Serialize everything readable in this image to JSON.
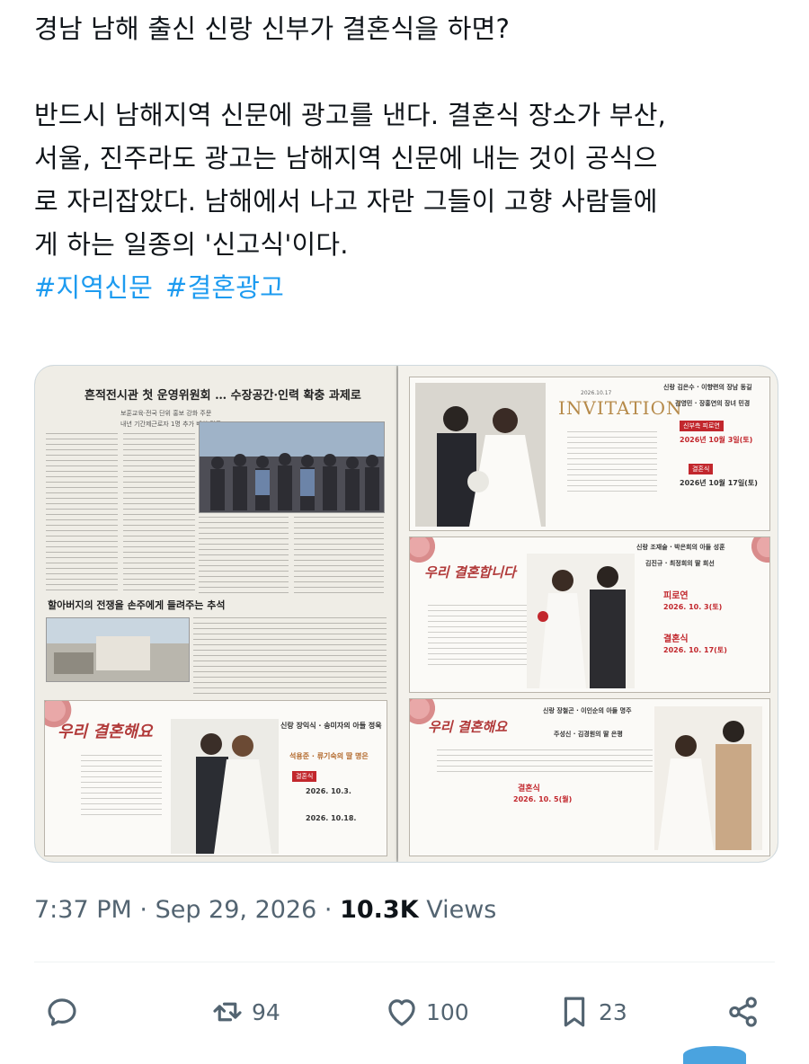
{
  "tweet": {
    "line1": "경남 남해 출신 신랑 신부가 결혼식을 하면?",
    "para2_line1": "반드시 남해지역 신문에 광고를 낸다. 결혼식 장소가 부산,",
    "para2_line2": "서울, 진주라도 광고는 남해지역 신문에 내는 것이 공식으",
    "para2_line3": "로 자리잡았다. 남해에서 나고 자란 그들이 고향 사람들에",
    "para2_line4": "게 하는 일종의 '신고식'이다.",
    "hashtags": [
      "#지역신문",
      "#결혼광고"
    ]
  },
  "photo": {
    "left_page": {
      "headline": "흔적전시관 첫 운영위원회 … 수장공간·인력 확충 과제로",
      "subhead": "보훈교육·전국 단위 홍보 강화 주문",
      "subhead2": "내년 기간제근로자 1명 추가 배치 검토",
      "headline2": "할아버지의 전쟁을 손주에게 들려주는 추석",
      "ad": {
        "script": "우리 결혼해요",
        "groom_family": "신랑 장익식 · 송미자의 아들 정욱",
        "bride_family": "석용준 · 류기숙의 딸 명은",
        "date1": "2026. 10.3.",
        "date2": "2026. 10.18."
      }
    },
    "right_page": {
      "ad1": {
        "date": "2026.10.17",
        "invitation": "INVITATION",
        "groom_family": "신랑 김은수 · 이향련의 장남 동길",
        "bride_family": "김영민 · 장홍연의 장녀 민경",
        "event1": "2026년 10월 3일(토)",
        "event2": "2026년 10월 17일(토)"
      },
      "ad2": {
        "script": "우리 결혼합니다",
        "groom_family": "신랑 조재술 · 박은희의 아들 성훈",
        "bride_family": "김진규 · 최정희의 딸 희선",
        "reception_label": "피로연",
        "reception_date": "2026. 10. 3(토)",
        "ceremony_label": "결혼식",
        "ceremony_date": "2026. 10. 17(토)"
      },
      "ad3": {
        "script": "우리 결혼해요",
        "groom_family": "신랑 장철곤 · 이인순의 아들 명주",
        "bride_family": "주성신 · 김경원의 딸 은평",
        "ceremony_label": "결혼식",
        "ceremony_date": "2026. 10. 5(월)"
      }
    }
  },
  "meta": {
    "time": "7:37 PM",
    "sep1": "·",
    "date": "Sep 29, 2026",
    "sep2": "·",
    "views_count": "10.3K",
    "views_label": "Views"
  },
  "actions": {
    "reply_count": "",
    "retweet_count": "94",
    "like_count": "100",
    "bookmark_count": "23"
  },
  "colors": {
    "text": "#0f1419",
    "secondary": "#536471",
    "link": "#1d9bf0",
    "accent_red": "#c2272d"
  }
}
